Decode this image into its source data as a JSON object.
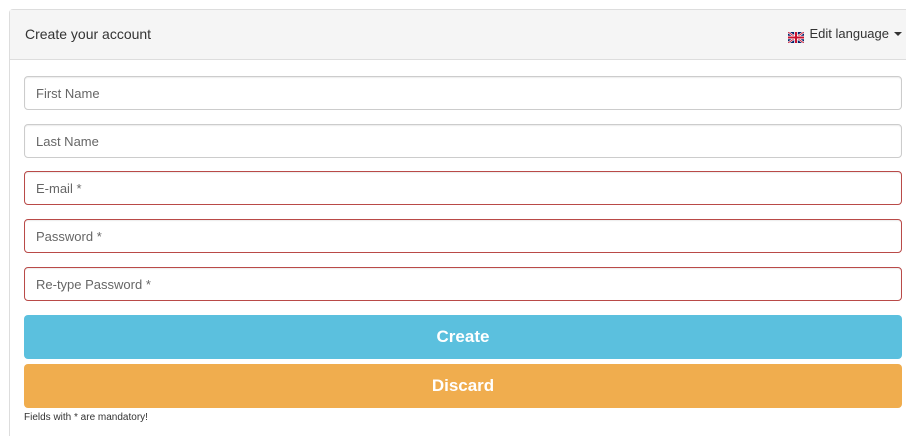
{
  "header": {
    "title": "Create your account",
    "language_label": "Edit language",
    "language_flag_icon": "uk-flag-icon"
  },
  "form": {
    "first_name": {
      "placeholder": "First Name",
      "value": ""
    },
    "last_name": {
      "placeholder": "Last Name",
      "value": ""
    },
    "email": {
      "placeholder": "E-mail *",
      "value": ""
    },
    "password": {
      "placeholder": "Password *",
      "value": ""
    },
    "retype_password": {
      "placeholder": "Re-type Password *",
      "value": ""
    }
  },
  "buttons": {
    "create_label": "Create",
    "discard_label": "Discard"
  },
  "note": "Fields with * are mandatory!",
  "colors": {
    "create": "#5bc0de",
    "discard": "#f0ad4e",
    "error_border": "#b94a48"
  }
}
